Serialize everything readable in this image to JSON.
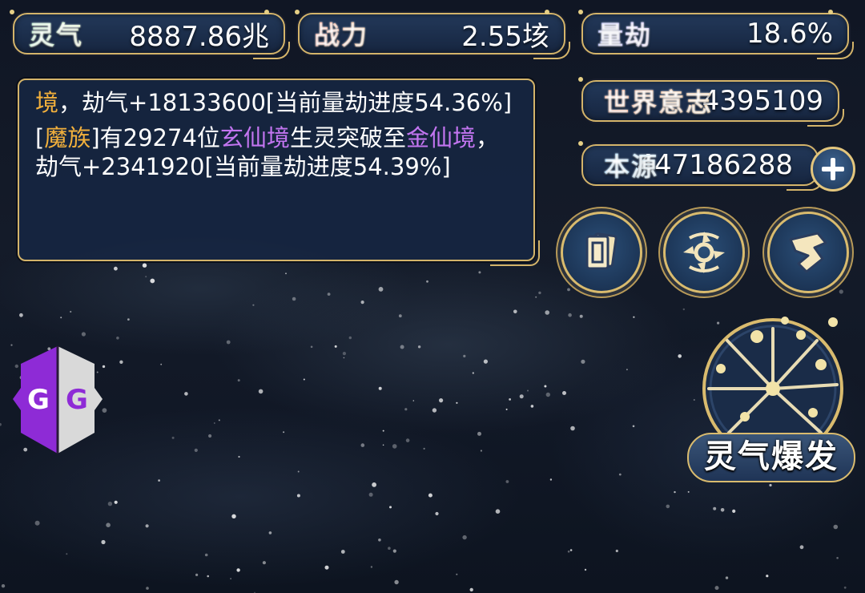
{
  "stats": {
    "lingqi": {
      "label": "灵气",
      "value": "8887.86兆"
    },
    "zhanli": {
      "label": "战力",
      "value": "2.55垓"
    },
    "liangjie": {
      "label": "量劫",
      "value": "18.6%"
    },
    "world_will": {
      "label": "世界意志",
      "value": "4395109"
    },
    "origin": {
      "label": "本源",
      "value": "447186288"
    }
  },
  "messages": [
    {
      "parts": [
        {
          "text": "境",
          "color": "orange"
        },
        {
          "text": "，劫气+18133600[当前量劫进度54.36%]",
          "color": "white"
        }
      ]
    },
    {
      "parts": [
        {
          "text": "[",
          "color": "white"
        },
        {
          "text": "魔族",
          "color": "orange"
        },
        {
          "text": "]有29274位",
          "color": "white"
        },
        {
          "text": "玄仙境",
          "color": "purple"
        },
        {
          "text": "生灵突破至",
          "color": "white"
        },
        {
          "text": "金仙境",
          "color": "purple"
        },
        {
          "text": "，劫气+2341920[当前量劫进度54.39%]",
          "color": "white"
        }
      ]
    }
  ],
  "actions": {
    "cards_icon": "cards-icon",
    "vortex_icon": "vortex-icon",
    "flag_icon": "flag-icon",
    "plus_icon": "plus-icon",
    "burst_label": "灵气爆发"
  },
  "overlay": {
    "logo_text": "GG"
  },
  "colors": {
    "gold_border": "#d4b46a",
    "panel_blue": "#1b2d4a",
    "text_orange": "#f2b03c",
    "text_purple": "#c275f0",
    "lingqi_label": "#7fe3a6",
    "zhanli_label": "#ef7a4f",
    "liangjie_label": "#8fa6ff",
    "world_will_label": "#f08a5a",
    "origin_label": "#6fc6ff"
  }
}
